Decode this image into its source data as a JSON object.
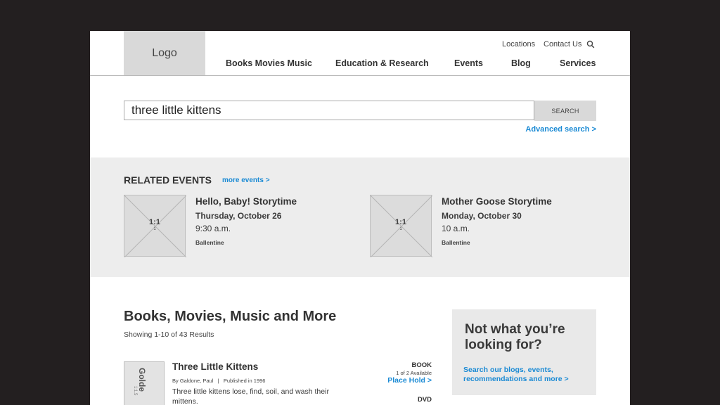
{
  "header": {
    "logo": "Logo",
    "utility_links": [
      "Locations",
      "Contact Us"
    ],
    "nav": [
      "Books Movies Music",
      "Education & Research",
      "Events",
      "Blog",
      "Services"
    ]
  },
  "search": {
    "query": "three little kittens",
    "button": "SEARCH",
    "advanced": "Advanced search >"
  },
  "events": {
    "title": "RELATED EVENTS",
    "more": "more events >",
    "items": [
      {
        "thumb_label": "1:1",
        "thumb_sub": "1",
        "title": "Hello, Baby! Storytime",
        "date": "Thursday, October 26",
        "time": "9:30 a.m.",
        "location": "Ballentine"
      },
      {
        "thumb_label": "1:1",
        "thumb_sub": "1",
        "title": "Mother Goose Storytime",
        "date": "Monday, October 30",
        "time": "10 a.m.",
        "location": "Ballentine"
      }
    ]
  },
  "results": {
    "title": "Books, Movies, Music and More",
    "count": "Showing 1-10 of 43 Results",
    "items": [
      {
        "thumb_text": "Golde",
        "thumb_sub": "1:1.5",
        "title": "Three Little Kittens",
        "meta": "By Galdone, Paul   |   Published in 1996",
        "desc": "Three little kittens lose, find, soil, and wash their mittens.",
        "format": "BOOK",
        "availability": "1 of 2 Available",
        "action": "Place Hold >",
        "next_format": "DVD"
      }
    ]
  },
  "sidebar": {
    "title": "Not what you’re looking for?",
    "link": "Search our blogs, events, recommendations and more >"
  },
  "colors": {
    "link": "#1a8ad4",
    "backdrop": "#231f20",
    "placeholder_gray": "#d9d9d9"
  }
}
